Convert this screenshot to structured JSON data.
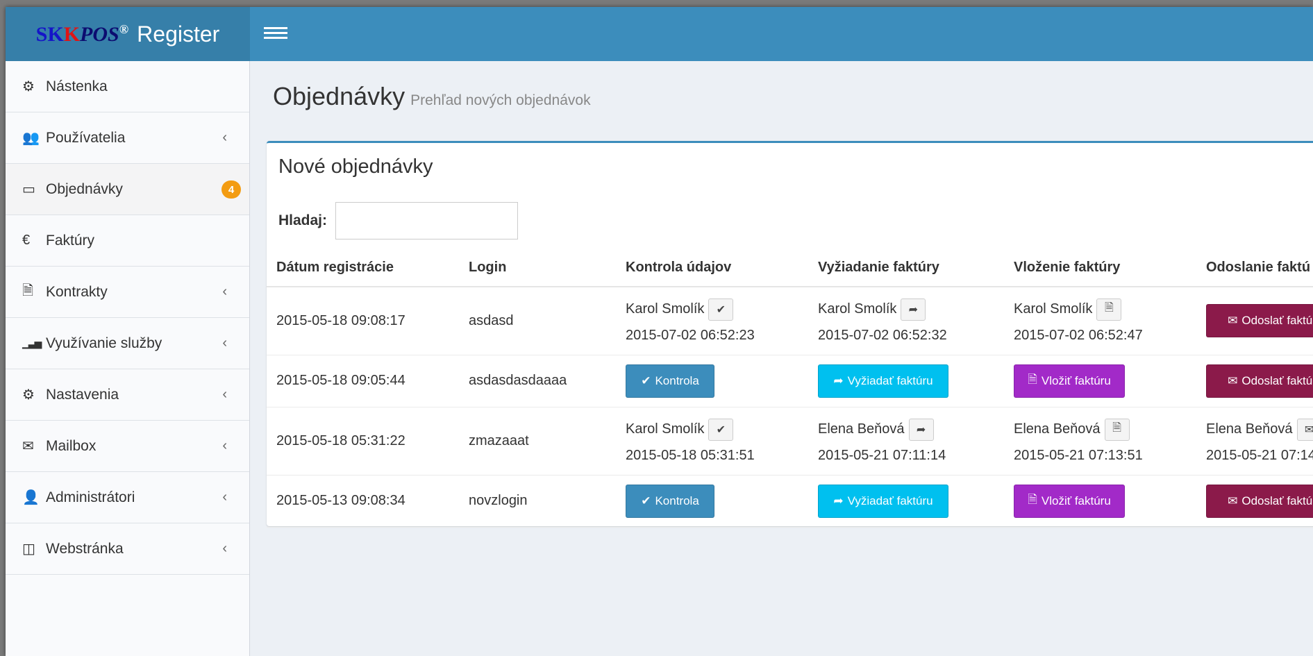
{
  "app": {
    "brand_sk": "SK",
    "brand_k": "K",
    "brand_pos": "POS",
    "brand_reg": "®",
    "title": "Register"
  },
  "sidebar": {
    "items": [
      {
        "label": "Nástenka",
        "icon": "dashboard-icon",
        "glyph": "⚙"
      },
      {
        "label": "Používatelia",
        "icon": "users-icon",
        "glyph": "👥",
        "caret": "‹"
      },
      {
        "label": "Objednávky",
        "icon": "credit-card-icon",
        "glyph": "▭",
        "badge": "4"
      },
      {
        "label": "Faktúry",
        "icon": "euro-icon",
        "glyph": "€"
      },
      {
        "label": "Kontrakty",
        "icon": "file-icon",
        "glyph": "🗎",
        "caret": "‹"
      },
      {
        "label": "Využívanie služby",
        "icon": "signal-icon",
        "glyph": "▁▃▅",
        "caret": "‹"
      },
      {
        "label": "Nastavenia",
        "icon": "cogs-icon",
        "glyph": "⚙",
        "caret": "‹"
      },
      {
        "label": "Mailbox",
        "icon": "envelope-icon",
        "glyph": "✉",
        "caret": "‹"
      },
      {
        "label": "Administrátori",
        "icon": "user-icon",
        "glyph": "👤",
        "caret": "‹"
      },
      {
        "label": "Webstránka",
        "icon": "columns-icon",
        "glyph": "◫",
        "caret": "‹"
      }
    ]
  },
  "header": {
    "title": "Objednávky",
    "subtitle": "Prehľad nových objednávok"
  },
  "box": {
    "title": "Nové objednávky",
    "search_label": "Hladaj:",
    "search_value": ""
  },
  "table": {
    "headers": [
      "Dátum registrácie",
      "Login",
      "Kontrola údajov",
      "Vyžiadanie faktúry",
      "Vloženie faktúry",
      "Odoslanie faktú"
    ],
    "rows": [
      {
        "date": "2015-05-18 09:08:17",
        "login": "asdasd",
        "kontrola": {
          "name": "Karol Smolík",
          "date": "2015-07-02 06:52:23"
        },
        "vyziadanie": {
          "name": "Karol Smolík",
          "date": "2015-07-02 06:52:32"
        },
        "vlozenie": {
          "name": "Karol Smolík",
          "date": "2015-07-02 06:52:47"
        },
        "odoslanie_btn": "Odoslať faktúr"
      },
      {
        "date": "2015-05-18 09:05:44",
        "login": "asdasdasdaaaa",
        "kontrola_btn": "Kontrola",
        "vyziadanie_btn": "Vyžiadať faktúru",
        "vlozenie_btn": "Vložiť faktúru",
        "odoslanie_btn": "Odoslať faktúr"
      },
      {
        "date": "2015-05-18 05:31:22",
        "login": "zmazaaat",
        "kontrola": {
          "name": "Karol Smolík",
          "date": "2015-05-18 05:31:51"
        },
        "vyziadanie": {
          "name": "Elena Beňová",
          "date": "2015-05-21 07:11:14"
        },
        "vlozenie": {
          "name": "Elena Beňová",
          "date": "2015-05-21 07:13:51"
        },
        "odoslanie": {
          "name": "Elena Beňová",
          "date": "2015-05-21 07:14"
        }
      },
      {
        "date": "2015-05-13 09:08:34",
        "login": "novzlogin",
        "kontrola_btn": "Kontrola",
        "vyziadanie_btn": "Vyžiadať faktúru",
        "vlozenie_btn": "Vložiť faktúru",
        "odoslanie_btn": "Odoslať faktúr"
      }
    ]
  },
  "icons": {
    "check": "✔",
    "share": "➦",
    "file": "🗎",
    "envelope": "✉"
  },
  "colors": {
    "topbar": "#3c8dbc",
    "logo_bg": "#367fa9",
    "btn_primary": "#3c8dbc",
    "btn_info": "#00c0ef",
    "btn_purple": "#a22ac8",
    "btn_maroon": "#8b1a4a",
    "badge": "#f39c12"
  }
}
